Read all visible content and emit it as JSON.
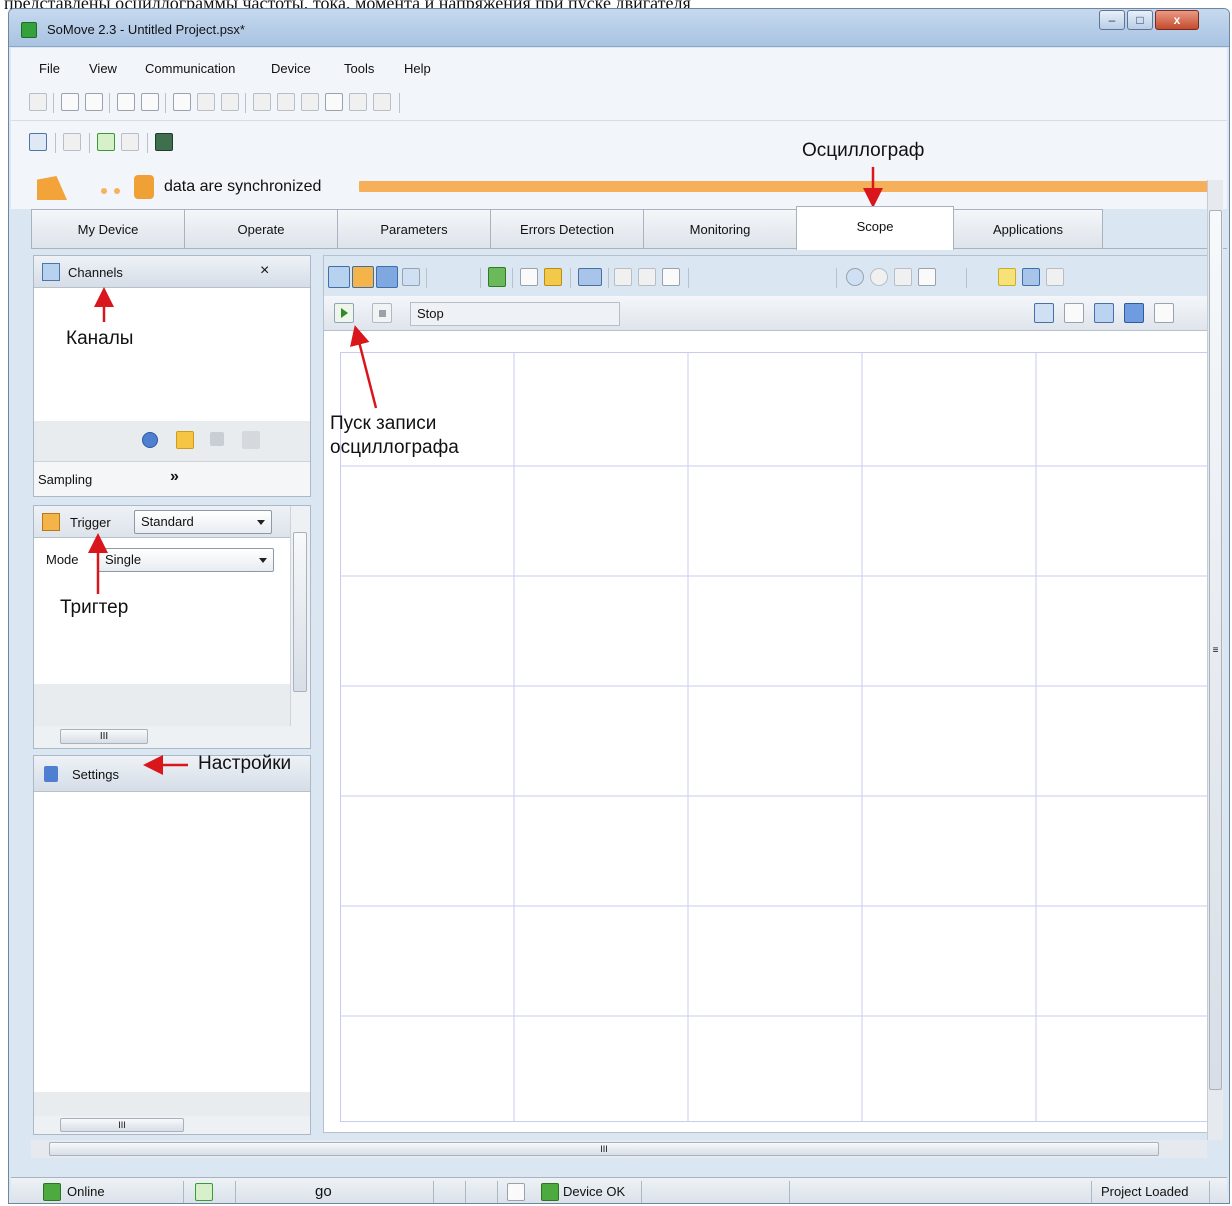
{
  "caption": "представлены осциллограммы частоты, тока, момента и напряжения при пуске двигателя",
  "window": {
    "title": "SoMove 2.3 - Untitled Project.psx*",
    "min": "–",
    "max": "□",
    "close": "x"
  },
  "menu": [
    "File",
    "View",
    "Communication",
    "Device",
    "Tools",
    "Help"
  ],
  "sync": {
    "status": "data are synchronized"
  },
  "tabs": [
    "My Device",
    "Operate",
    "Parameters",
    "Errors Detection",
    "Monitoring",
    "Scope",
    "Applications"
  ],
  "channels": {
    "title": "Channels",
    "close": "×",
    "sampling": "Sampling",
    "collapse": "»"
  },
  "trigger": {
    "title": "Trigger",
    "type": "Standard",
    "mode_label": "Mode",
    "mode": "Single"
  },
  "settings": {
    "title": "Settings"
  },
  "scope": {
    "state": "Stop"
  },
  "scroll": {
    "grip": "III",
    "grip_v": "≡"
  },
  "status": {
    "online": "Online",
    "device": "Device OK",
    "project": "Project Loaded",
    "counter": "go"
  },
  "annotations": {
    "scope": "Осциллограф",
    "channels": "Каналы",
    "start": "Пуск записи осциллографа",
    "trigger": "Тригтер",
    "settings": "Настройки"
  },
  "colors": {
    "accent": "#f7b05a",
    "grid": "#c9cbf2",
    "arrow": "#d9161b"
  }
}
